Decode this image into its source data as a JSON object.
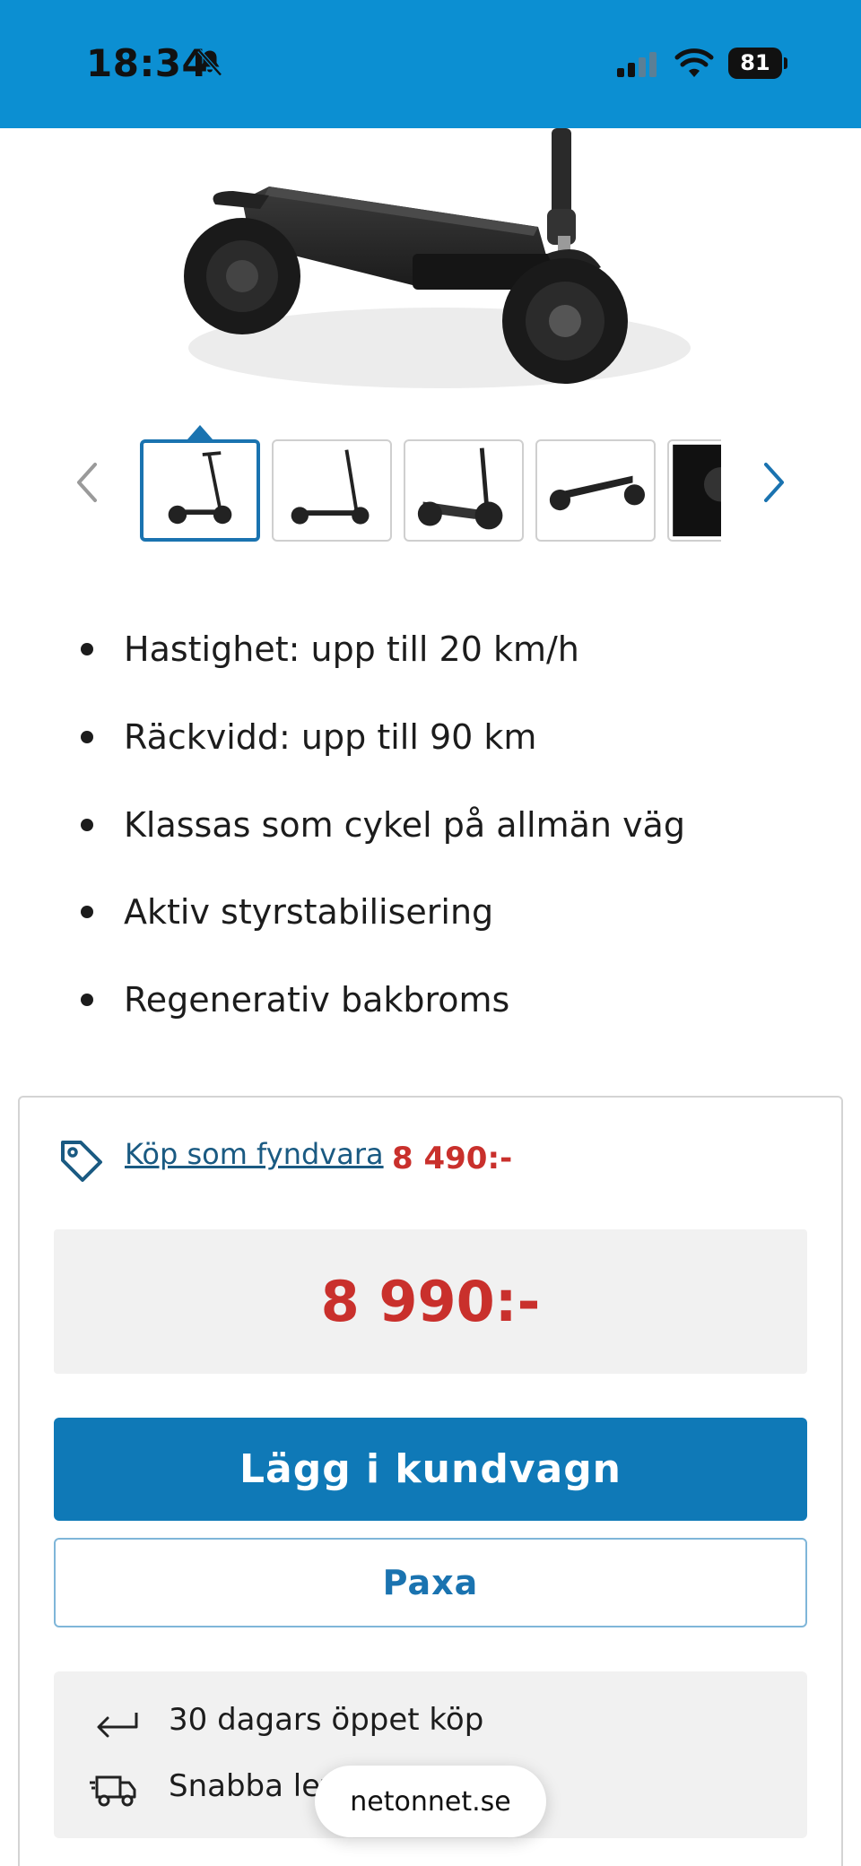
{
  "status_bar": {
    "time": "18:34",
    "battery": "81",
    "background_color": "#0c8fd2",
    "icons": [
      "bell-slash-icon",
      "signal-icon",
      "wifi-icon",
      "battery-icon"
    ]
  },
  "gallery": {
    "thumbnail_count_visible": 5,
    "selected_index": 0,
    "prev_icon": "chevron-left-icon",
    "next_icon": "chevron-right-icon"
  },
  "features": [
    "Hastighet: upp till 20 km/h",
    "Räckvidd: upp till 90 km",
    "Klassas som cykel på allmän väg",
    "Aktiv styrstabilisering",
    "Regenerativ bakbroms"
  ],
  "buy_box": {
    "bargain_icon": "tag-icon",
    "bargain_link": "Köp som fyndvara",
    "bargain_price": "8 490:-",
    "price": "8 990:-",
    "cart_button": "Lägg i kundvagn",
    "paxa_button": "Paxa",
    "perks": [
      {
        "icon": "return-arrow-icon",
        "text": "30 dagars öppet köp"
      },
      {
        "icon": "delivery-truck-icon",
        "text": "Snabba lev"
      }
    ]
  },
  "browser": {
    "url": "netonnet.se"
  },
  "colors": {
    "accent_blue": "#0f79b7",
    "price_red": "#c9302c",
    "link_blue": "#1a5a82"
  }
}
